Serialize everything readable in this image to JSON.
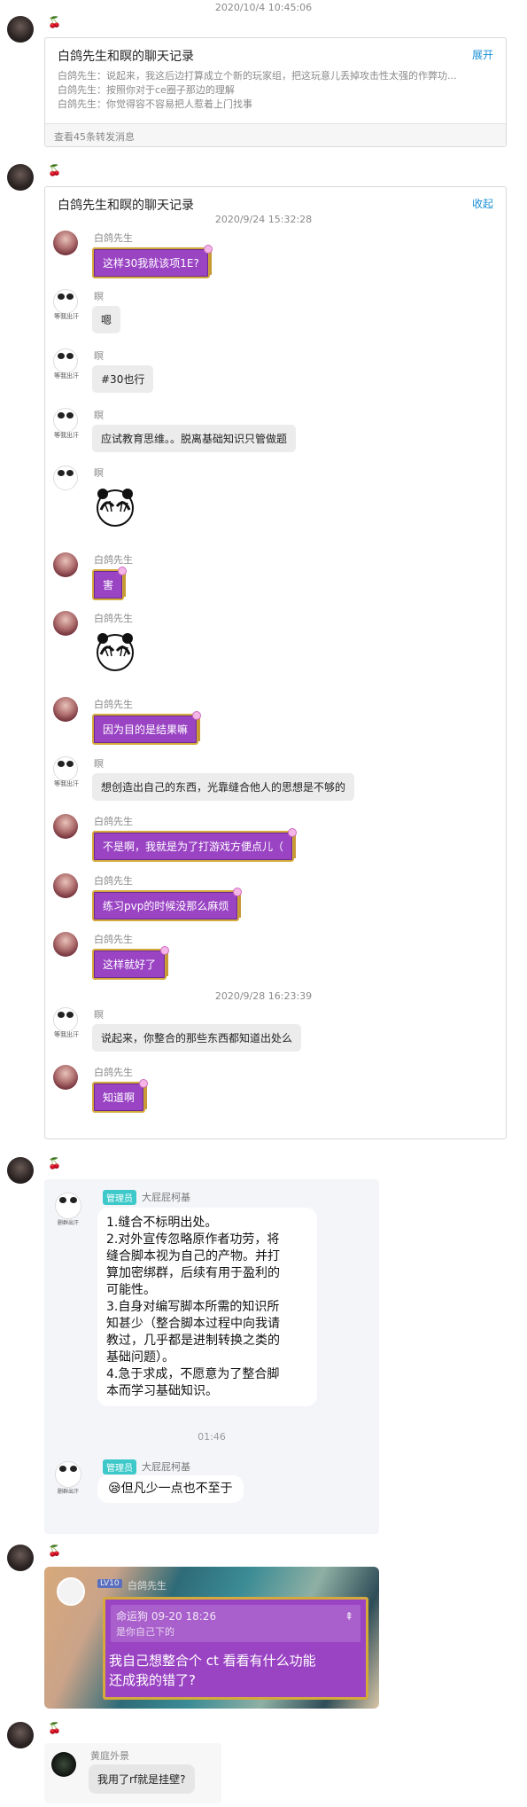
{
  "top_time": "2020/10/4 10:45:06",
  "sender_icon": "🍒",
  "msg1": {
    "title": "白鸽先生和瞑的聊天记录",
    "toggle": "展开",
    "lines": [
      "白鸽先生：说起来，我这后边打算成立个新的玩家组，把这玩意儿丢掉攻击性太强的作弊功...",
      "白鸽先生：按照你对于ce圈子那边的理解",
      "白鸽先生：你觉得容不容易把人惹着上门找事"
    ],
    "footer": "查看45条转发消息"
  },
  "msg2": {
    "title": "白鸽先生和瞑的聊天记录",
    "toggle": "收起",
    "time1": "2020/9/24 15:32:28",
    "time2": "2020/9/28 16:23:39",
    "name_a": "白鸽先生",
    "name_b": "瞑",
    "avatar_caption": "等我出汗",
    "messages": [
      {
        "who": "a",
        "text": "这样30我就该项1E?"
      },
      {
        "who": "b",
        "text": "嗯"
      },
      {
        "who": "b",
        "text": "#30也行"
      },
      {
        "who": "b",
        "text": "应试教育思维。。脱离基础知识只管做题"
      },
      {
        "who": "b",
        "sticker": "cover-face-sticker"
      },
      {
        "who": "a",
        "text": "害"
      },
      {
        "who": "a",
        "sticker": "cover-face-sticker"
      },
      {
        "who": "a",
        "text": "因为目的是结果嘛"
      },
      {
        "who": "b",
        "text": "想创造出自己的东西，光靠缝合他人的思想是不够的"
      },
      {
        "who": "a",
        "text": "不是啊，我就是为了打游戏方便点儿（"
      },
      {
        "who": "a",
        "text": "练习pvp的时候没那么麻烦"
      },
      {
        "who": "a",
        "text": "这样就好了"
      },
      {
        "who": "b",
        "text": "说起来，你整合的那些东西都知道出处么"
      },
      {
        "who": "a",
        "text": "知道啊"
      }
    ]
  },
  "msg3": {
    "badge": "管理员",
    "name": "大屁屁柯基",
    "avatar_caption": "删群出汗",
    "lines": [
      "1.缝合不标明出处。",
      "2.对外宣传忽略原作者功劳，将",
      "缝合脚本视为自己的产物。并打",
      "算加密绑群，后续有用于盈利的",
      "可能性。",
      "3.自身对编写脚本所需的知识所",
      "知甚少（整合脚本过程中向我请",
      "教过，几乎都是进制转换之类的",
      "基础问题）。",
      "4.急于求成，不愿意为了整合脚",
      "本而学习基础知识。"
    ],
    "time": "01:46",
    "reply": "但凡少一点也不至于",
    "reply_emoji": "😪"
  },
  "msg4": {
    "level": "LV10",
    "name": "白鸽先生",
    "quote_head": "命运狗 09-20 18:26",
    "quote_sub": "是你自己下的",
    "text_line1": "我自己想整合个 ct 看看有什么功能",
    "text_line2": "还成我的错了?"
  },
  "msg5": {
    "name": "黄庭外景",
    "text": "我用了rf就是挂壁?"
  }
}
